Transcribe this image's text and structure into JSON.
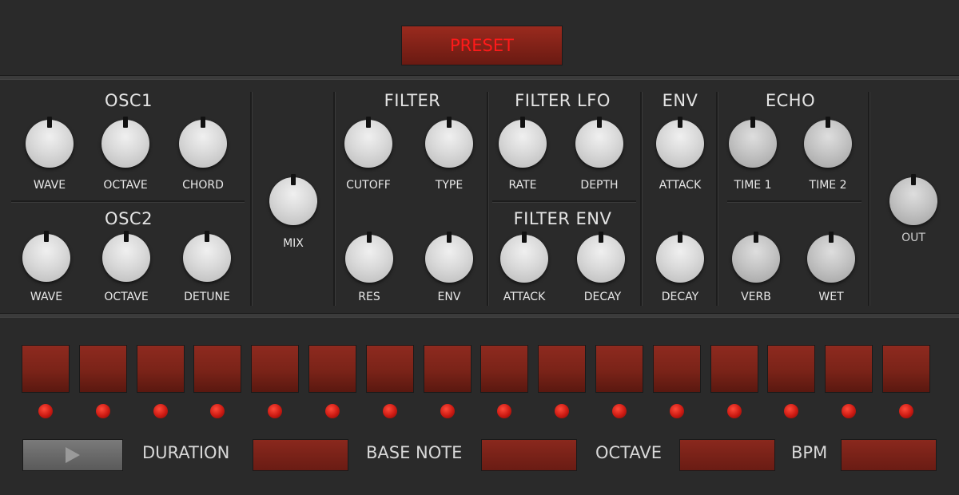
{
  "preset": {
    "label": "PRESET"
  },
  "sections": {
    "osc1": "OSC1",
    "osc2": "OSC2",
    "filter": "FILTER",
    "filter_lfo": "FILTER LFO",
    "filter_env": "FILTER ENV",
    "env": "ENV",
    "echo": "ECHO"
  },
  "knobs": {
    "osc1_wave": "WAVE",
    "osc1_octave": "OCTAVE",
    "osc1_chord": "CHORD",
    "osc2_wave": "WAVE",
    "osc2_octave": "OCTAVE",
    "osc2_detune": "DETUNE",
    "mix": "MIX",
    "cutoff": "CUTOFF",
    "type": "TYPE",
    "res": "RES",
    "filter_env": "ENV",
    "lfo_rate": "RATE",
    "lfo_depth": "DEPTH",
    "fenv_attack": "ATTACK",
    "fenv_decay": "DECAY",
    "env_attack": "ATTACK",
    "env_decay": "DECAY",
    "time1": "TIME 1",
    "time2": "TIME 2",
    "verb": "VERB",
    "wet": "WET",
    "out": "OUT"
  },
  "sequencer": {
    "step_count": 16,
    "led_color": "#e02a1e",
    "step_color": "#7a2318"
  },
  "bottom": {
    "play_icon": "play-icon",
    "duration": "DURATION",
    "base_note": "BASE NOTE",
    "octave": "OCTAVE",
    "bpm": "BPM"
  }
}
